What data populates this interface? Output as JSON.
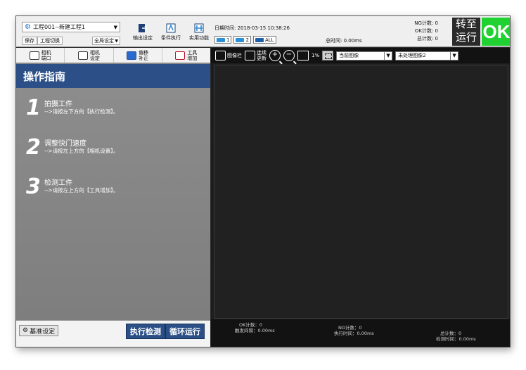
{
  "header": {
    "project": "工程001--新建工程1",
    "save_label": "保存",
    "switch_project_label": "工程切换",
    "global_settings_label": "全局设定",
    "tools": [
      {
        "label": "输出设定",
        "icon": "output-settings-icon"
      },
      {
        "label": "条件执行",
        "icon": "condition-execute-icon"
      },
      {
        "label": "实用功能",
        "icon": "utility-icon"
      }
    ],
    "datetime": "日期时间: 2018-03-15 10:38:26",
    "cameras": [
      "1",
      "2",
      "ALL"
    ],
    "total_time": "总时间: 0.00ms",
    "ng_count": "NG计数: 0",
    "ok_count": "OK计数: 0",
    "total_count": "总计数: 0",
    "goto_run": [
      "转至",
      "运行"
    ],
    "result": "OK",
    "colors": {
      "ok": "#1fd131",
      "guide": "#2b4f86",
      "camera_chip": "#2e8fd6"
    }
  },
  "left": {
    "tabs": [
      {
        "label": [
          "相机",
          "端口"
        ],
        "icon": "camera-port-icon"
      },
      {
        "label": [
          "相机",
          "设定"
        ],
        "icon": "camera-settings-icon"
      },
      {
        "label": [
          "偏移",
          "补正"
        ],
        "icon": "offset-correction-icon"
      },
      {
        "label": [
          "工具",
          "增加"
        ],
        "icon": "add-tool-icon"
      }
    ],
    "guide_title": "操作指南",
    "steps": [
      {
        "num": "1",
        "title": "拍摄工件",
        "desc": "-->请按左下方的【执行检测】。"
      },
      {
        "num": "2",
        "title": "调整快门速度",
        "desc": "-->请按左上方的【相机设置】。"
      },
      {
        "num": "3",
        "title": "检测工件",
        "desc": "-->请按左上方的【工具增加】。"
      }
    ],
    "base_settings_label": "基准设定",
    "execute_label": "执行检测",
    "loop_run_label": "循环运行"
  },
  "right": {
    "image_bar_label": "图像栏",
    "continuous_update_label": [
      "连续",
      "更新"
    ],
    "zoom_level": "1%",
    "image_source": "当前图像",
    "image_processing": "未处理图像2",
    "status": {
      "ok_count": "OK计数：0",
      "trigger_interval": "触发间隔：0.00ms",
      "ng_count": "NG计数：0",
      "exec_time": "执行时间：0.00ms",
      "total_count": "总计数：0",
      "detect_time": "检测时间：0.00ms"
    }
  }
}
